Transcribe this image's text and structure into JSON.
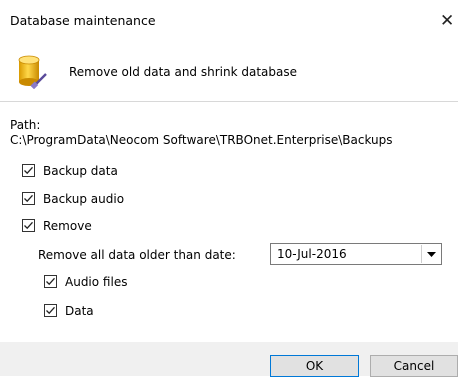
{
  "window": {
    "title": "Database maintenance",
    "close_glyph": "✕"
  },
  "header": {
    "icon": "database-brush-icon",
    "text": "Remove old data and shrink database"
  },
  "path": {
    "label": "Path:",
    "value": "C:\\ProgramData\\Neocom Software\\TRBOnet.Enterprise\\Backups"
  },
  "options": {
    "backup_data": {
      "label": "Backup data",
      "checked": true
    },
    "backup_audio": {
      "label": "Backup audio",
      "checked": true
    },
    "remove": {
      "label": "Remove",
      "checked": true
    }
  },
  "remove_settings": {
    "older_label": "Remove all data older than date:",
    "date_value": "10-Jul-2016",
    "audio_files": {
      "label": "Audio files",
      "checked": true
    },
    "data": {
      "label": "Data",
      "checked": true
    }
  },
  "buttons": {
    "ok": "OK",
    "cancel": "Cancel"
  },
  "colors": {
    "focus_border": "#0078d7",
    "button_face": "#e1e1e1",
    "footer_bg": "#f0f0f0",
    "icon_gold": "#f5c518"
  }
}
